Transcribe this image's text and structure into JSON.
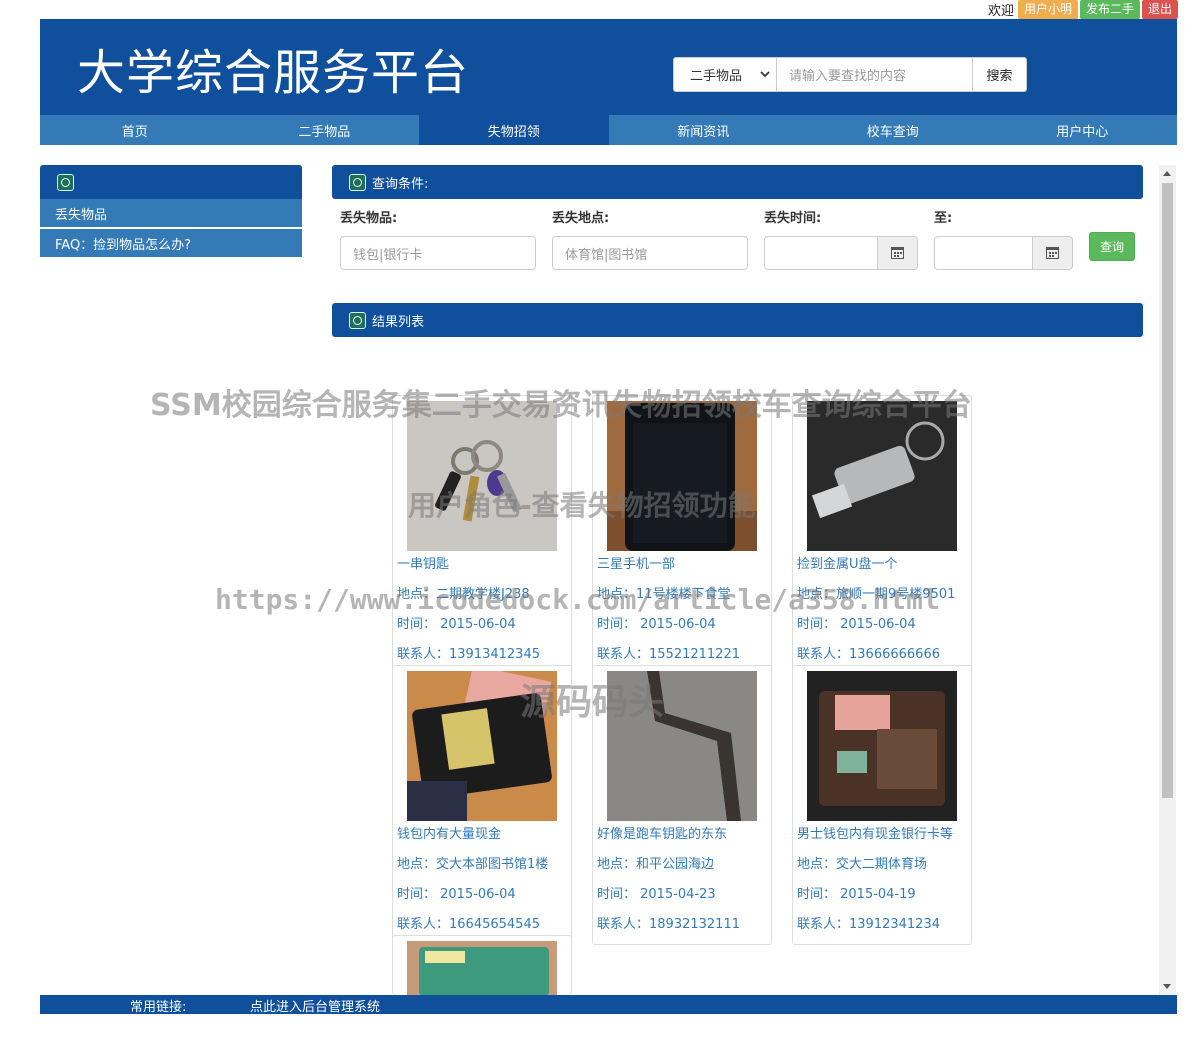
{
  "topbar": {
    "welcome": "欢迎",
    "user": "用户小明",
    "publish": "发布二手",
    "logout": "退出"
  },
  "header": {
    "title": "大学综合服务平台",
    "search": {
      "category": "二手物品",
      "placeholder": "请输入要查找的内容",
      "button": "搜索"
    }
  },
  "nav": [
    {
      "label": "首页"
    },
    {
      "label": "二手物品"
    },
    {
      "label": "失物招领",
      "active": true
    },
    {
      "label": "新闻资讯"
    },
    {
      "label": "校车查询"
    },
    {
      "label": "用户中心"
    }
  ],
  "sidebar": {
    "items": [
      {
        "label": "丢失物品"
      },
      {
        "label": "FAQ：捡到物品怎么办?"
      }
    ]
  },
  "query": {
    "title": "查询条件:",
    "labels": {
      "item": "丢失物品:",
      "place": "丢失地点:",
      "time": "丢失时间:",
      "to": "至:"
    },
    "placeholders": {
      "item": "钱包|银行卡",
      "place": "体育馆|图书馆"
    },
    "button": "查询"
  },
  "results": {
    "title": "结果列表",
    "cards": [
      {
        "name": "一串钥匙",
        "place": "地点：二期教学楼J238",
        "time": "时间： 2015-06-04",
        "contact": "联系人：13913412345"
      },
      {
        "name": "三星手机一部",
        "place": "地点：11号楼楼下食堂",
        "time": "时间： 2015-06-04",
        "contact": "联系人：15521211221"
      },
      {
        "name": "捡到金属U盘一个",
        "place": "地点：旅顺一期9号楼9501",
        "time": "时间： 2015-06-04",
        "contact": "联系人：13666666666"
      },
      {
        "name": "钱包内有大量现金",
        "place": "地点：交大本部图书馆1楼",
        "time": "时间： 2015-06-04",
        "contact": "联系人：16645654545"
      },
      {
        "name": "好像是跑车钥匙的东东",
        "place": "地点：和平公园海边",
        "time": "时间： 2015-04-23",
        "contact": "联系人：18932132111"
      },
      {
        "name": "男士钱包内有现金银行卡等",
        "place": "地点：交大二期体育场",
        "time": "时间： 2015-04-19",
        "contact": "联系人：13912341234"
      }
    ]
  },
  "footer": {
    "links_label": "常用链接:",
    "admin_link": "点此进入后台管理系统"
  },
  "watermarks": {
    "title": "SSM校园综合服务集二手交易资讯失物招领校车查询综合平台",
    "subtitle": "用户角色-查看失物招领功能",
    "url": "https://www.icodedock.com/article/a358.html",
    "brand": "源码码头"
  },
  "colors": {
    "primary": "#0f4f9b",
    "nav": "#337ab7",
    "success": "#5cb85c",
    "warning": "#f0ad4e",
    "danger": "#d9534f"
  }
}
